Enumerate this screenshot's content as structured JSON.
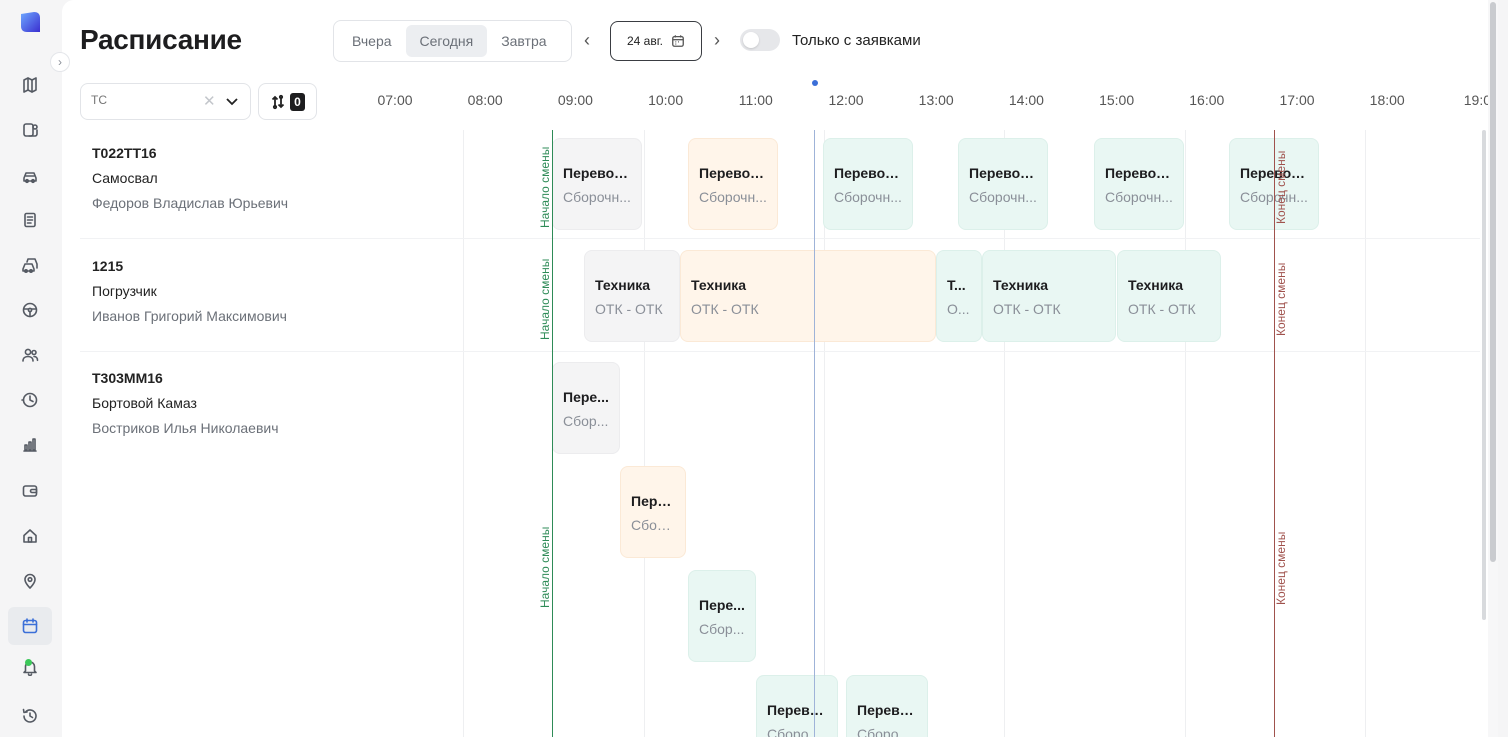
{
  "page": {
    "title": "Расписание",
    "day_tabs": [
      "Вчера",
      "Сегодня",
      "Завтра"
    ],
    "active_tab": "Сегодня",
    "date_label": "24 авг.",
    "toggle_label": "Только с заявками",
    "toggle_on": false,
    "filter_placeholder": "ТС",
    "sort_count": "0"
  },
  "sidebar": {
    "icons": [
      "logo-icon",
      "map-icon",
      "routes-icon",
      "vehicle-icon",
      "document-icon",
      "fleet-icon",
      "steering-wheel-icon",
      "users-icon",
      "history-clock-icon",
      "chart-icon",
      "wallet-icon",
      "home-icon",
      "location-pin-icon",
      "calendar-icon",
      "bell-icon",
      "recent-history-icon"
    ],
    "active": "calendar-icon",
    "notification_dot": true
  },
  "timeline": {
    "hours": [
      "07:00",
      "08:00",
      "09:00",
      "10:00",
      "11:00",
      "12:00",
      "13:00",
      "14:00",
      "15:00",
      "16:00",
      "17:00",
      "18:00",
      "19:0"
    ],
    "shift_start_label": "Начало смены",
    "shift_end_label": "Конец смены",
    "rows": [
      {
        "plate": "Т022ТТ16",
        "type": "Самосвал",
        "driver": "Федоров Владислав Юрьевич",
        "blocks": [
          {
            "title": "Перевоз...",
            "subtitle": "Сборочн...",
            "status": "gray"
          },
          {
            "title": "Перевоз...",
            "subtitle": "Сборочн...",
            "status": "orange"
          },
          {
            "title": "Перевоз...",
            "subtitle": "Сборочн...",
            "status": "teal"
          },
          {
            "title": "Перевоз...",
            "subtitle": "Сборочн...",
            "status": "teal"
          },
          {
            "title": "Перевоз...",
            "subtitle": "Сборочн...",
            "status": "teal"
          },
          {
            "title": "Перевоз...",
            "subtitle": "Сборочн...",
            "status": "teal"
          }
        ]
      },
      {
        "plate": "1215",
        "type": "Погрузчик",
        "driver": "Иванов Григорий Максимович",
        "blocks": [
          {
            "title": "Техника",
            "subtitle": "ОТК - ОТК",
            "status": "gray"
          },
          {
            "title": "Техника",
            "subtitle": "ОТК - ОТК",
            "status": "orange"
          },
          {
            "title": "Т...",
            "subtitle": "О...",
            "status": "teal"
          },
          {
            "title": "Техника",
            "subtitle": "ОТК - ОТК",
            "status": "teal"
          },
          {
            "title": "Техника",
            "subtitle": "ОТК - ОТК",
            "status": "teal"
          }
        ]
      },
      {
        "plate": "Т303ММ16",
        "type": "Бортовой Камаз",
        "driver": "Востриков Илья Николаевич",
        "blocks": [
          {
            "title": "Пере...",
            "subtitle": "Сбор...",
            "status": "gray"
          },
          {
            "title": "Пере...",
            "subtitle": "Сбор...",
            "status": "orange"
          },
          {
            "title": "Пере...",
            "subtitle": "Сбор...",
            "status": "teal"
          },
          {
            "title": "Перево...",
            "subtitle": "Сборочн...",
            "status": "teal"
          },
          {
            "title": "Перево...",
            "subtitle": "Сборочн...",
            "status": "teal"
          }
        ]
      }
    ]
  },
  "colors": {
    "accent": "#3b6fd8",
    "shift_start": "#2e8b57",
    "shift_end": "#a0524d",
    "now_line": "#9fb3d8",
    "block_gray": "#f4f4f5",
    "block_orange": "#fff5ea",
    "block_teal": "#e9f7f3"
  }
}
